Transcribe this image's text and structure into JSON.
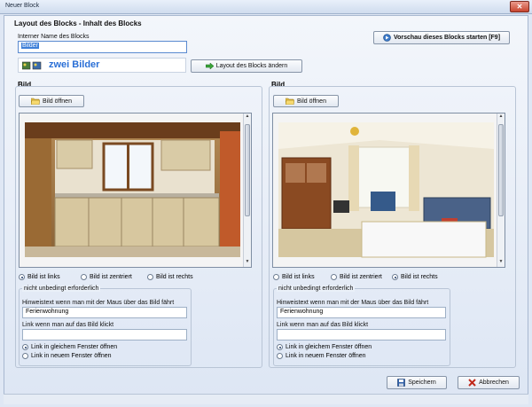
{
  "window": {
    "title": "Neuer Block",
    "close_symbol": "✕"
  },
  "section": {
    "title": "Layout des Blocks - Inhalt des Blocks"
  },
  "internal_name": {
    "label": "Interner Name des Blocks",
    "value": "Bilder"
  },
  "layout_preview": {
    "label": "zwei Bilder"
  },
  "buttons": {
    "preview": "Vorschau dieses Blocks starten [F9]",
    "change_layout": "Layout des Blocks ändern",
    "save": "Speichern",
    "cancel": "Abbrechen"
  },
  "left": {
    "title": "Bild",
    "open_button": "Bild öffnen",
    "align_options": [
      "Bild ist links",
      "Bild ist zentriert",
      "Bild ist rechts"
    ],
    "align_selected": 0,
    "optional_title": "nicht unbedingt erforderlich",
    "hover_label": "Hinweistext wenn man mit der Maus über das Bild fährt",
    "hover_value": "Ferienwohnung",
    "link_label": "Link wenn man auf das Bild klickt",
    "link_value": "",
    "link_options": [
      "Link in gleichem Fenster öffnen",
      "Link in neuem Fenster öffnen"
    ],
    "link_selected": 0
  },
  "right": {
    "title": "Bild",
    "open_button": "Bild öffnen",
    "align_options": [
      "Bild ist links",
      "Bild ist zentriert",
      "Bild ist rechts"
    ],
    "align_selected": 2,
    "optional_title": "nicht unbedingt erforderlich",
    "hover_label": "Hinweistext wenn man mit der Maus über das Bild fährt",
    "hover_value": "Ferienwohnung",
    "link_label": "Link wenn man auf das Bild klickt",
    "link_value": "",
    "link_options": [
      "Link in gleichem Fenster öffnen",
      "Link in neuem Fenster öffnen"
    ],
    "link_selected": 0
  },
  "colors": {
    "accent": "#2a6fd6",
    "selected_input": "#3d7fd8"
  }
}
